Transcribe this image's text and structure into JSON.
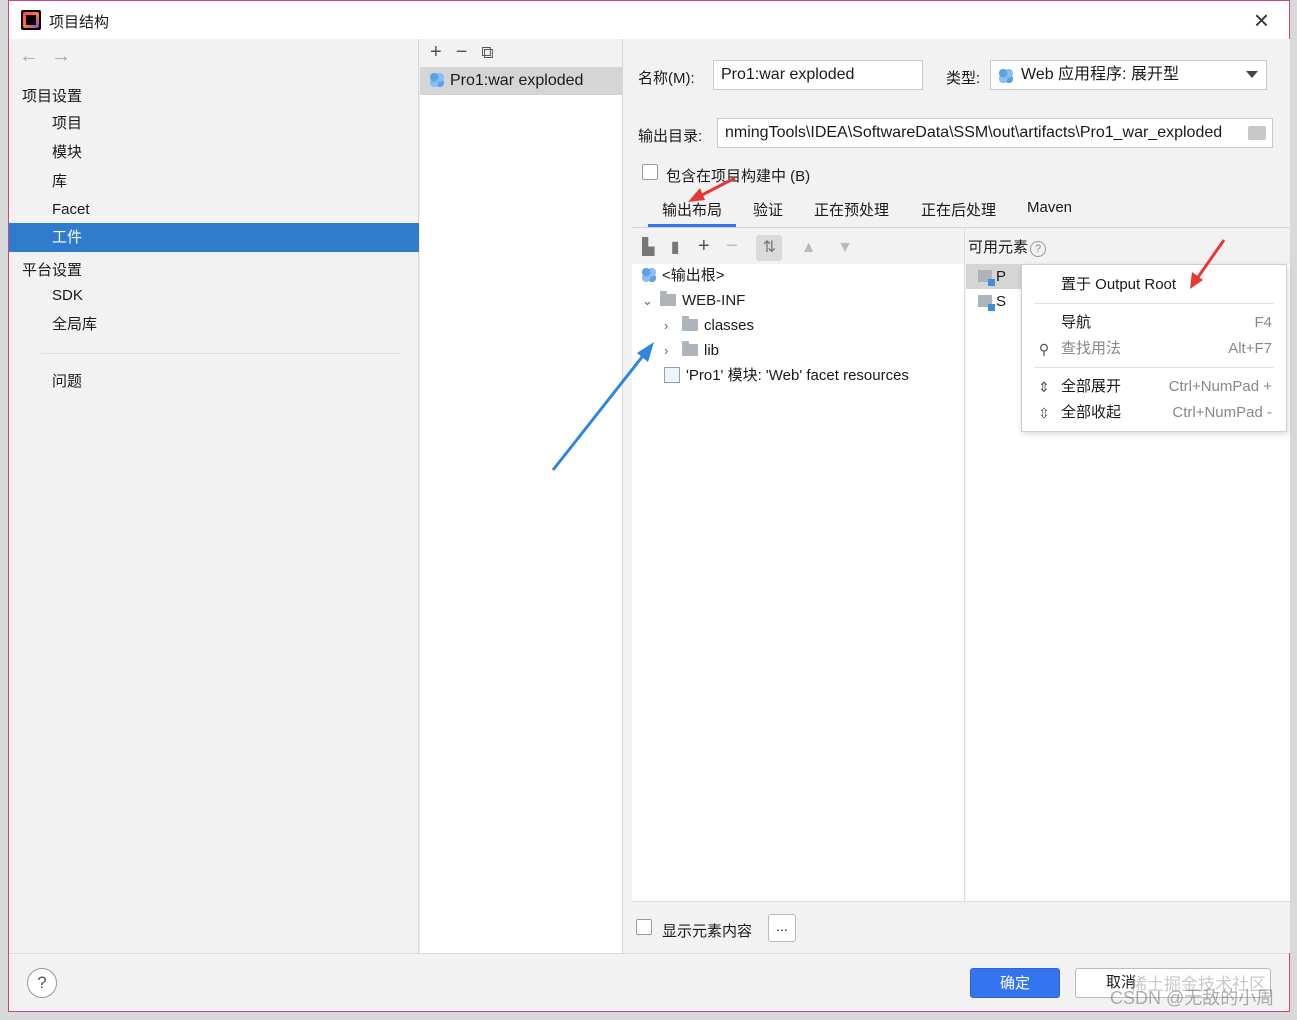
{
  "window": {
    "title": "项目结构",
    "close_icon": "×"
  },
  "nav": {
    "back": "←",
    "forward": "→"
  },
  "sidebar": {
    "project_settings": "项目设置",
    "items_project": [
      {
        "label": "项目"
      },
      {
        "label": "模块"
      },
      {
        "label": "库"
      },
      {
        "label": "Facet"
      },
      {
        "label": "工件"
      }
    ],
    "platform_settings": "平台设置",
    "items_platform": [
      {
        "label": "SDK"
      },
      {
        "label": "全局库"
      }
    ],
    "problems": "问题",
    "selected": "工件"
  },
  "artifacts": {
    "toolbar": {
      "add": "+",
      "remove": "−",
      "copy": "⧉"
    },
    "list": [
      {
        "label": "Pro1:war exploded"
      }
    ]
  },
  "form": {
    "name_label": "名称(M):",
    "name_value": "Pro1:war exploded",
    "type_label": "类型:",
    "type_value": "Web 应用程序: 展开型",
    "output_dir_label": "输出目录:",
    "output_dir_value": "nmingTools\\IDEA\\SoftwareData\\SSM\\out\\artifacts\\Pro1_war_exploded",
    "include_in_build_label": "包含在项目构建中 (B)"
  },
  "tabs": [
    {
      "label": "输出布局"
    },
    {
      "label": "验证"
    },
    {
      "label": "正在预处理"
    },
    {
      "label": "正在后处理"
    },
    {
      "label": "Maven"
    }
  ],
  "output_tree": [
    {
      "label": "<输出根>"
    },
    {
      "label": "WEB-INF"
    },
    {
      "label": "classes"
    },
    {
      "label": "lib"
    },
    {
      "label": "'Pro1' 模块: 'Web' facet resources"
    }
  ],
  "available": {
    "label": "可用元素",
    "help": "?",
    "items": [
      {
        "label": "P"
      },
      {
        "label": "S"
      }
    ]
  },
  "context_menu": [
    {
      "label": "置于 Output Root",
      "shortcut": ""
    },
    {
      "label": "导航",
      "shortcut": "F4"
    },
    {
      "label": "查找用法",
      "shortcut": "Alt+F7"
    },
    {
      "label": "全部展开",
      "shortcut": "Ctrl+NumPad +"
    },
    {
      "label": "全部收起",
      "shortcut": "Ctrl+NumPad -"
    }
  ],
  "show_contents_label": "显示元素内容",
  "dots_label": "...",
  "footer": {
    "help": "?",
    "ok": "确定",
    "cancel": "取消"
  },
  "watermark": {
    "line1": "稀土掘金技术社区",
    "line2": "CSDN @无敌的小周"
  },
  "colors": {
    "selection": "#2f7ccc",
    "primary_button": "#3574f0",
    "annotation_red": "#e53935",
    "annotation_blue": "#2f86e0",
    "window_border": "#c8458f"
  }
}
